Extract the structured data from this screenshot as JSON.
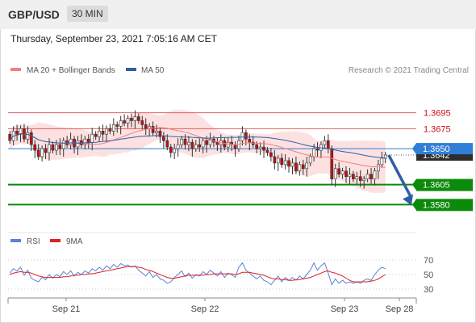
{
  "header": {
    "symbol": "GBP/USD",
    "timeframe": "30 MIN"
  },
  "datetime": "Thursday, September 23, 2021 7:05:16 AM CET",
  "copyright": "Research © 2021 Trading Central",
  "colors": {
    "ma20": "#f08080",
    "bands": "#fcd9d9",
    "ma50": "#2f5ea7",
    "resistance": "#e06060",
    "support": "#0c8a0c",
    "pivot": "#2f7ed8",
    "up": "#ffffff",
    "down": "#c01010",
    "rsi": "#5b82d6",
    "rsi_ma": "#dd2222",
    "arrow": "#2f5ea7"
  },
  "chart_data": [
    {
      "type": "candlestick",
      "legend": [
        "MA 20 + Bollinger Bands",
        "MA 50"
      ],
      "ylim": [
        1.355,
        1.3735
      ],
      "x_ticks": [
        "Sep 21",
        "Sep 22",
        "Sep 23",
        "Sep 28"
      ],
      "levels": [
        {
          "label": "1.3695",
          "value": 1.3695,
          "kind": "resistance"
        },
        {
          "label": "1.3675",
          "value": 1.3675,
          "kind": "resistance"
        },
        {
          "label": "1.3650",
          "value": 1.365,
          "kind": "pivot"
        },
        {
          "label": "1.3642",
          "value": 1.3642,
          "kind": "last"
        },
        {
          "label": "1.3605",
          "value": 1.3605,
          "kind": "support"
        },
        {
          "label": "1.3580",
          "value": 1.358,
          "kind": "support"
        }
      ],
      "closes": [
        1.366,
        1.3672,
        1.3668,
        1.3675,
        1.3662,
        1.367,
        1.3655,
        1.3648,
        1.364,
        1.365,
        1.3645,
        1.3655,
        1.3648,
        1.3655,
        1.365,
        1.366,
        1.3655,
        1.3662,
        1.3652,
        1.366,
        1.3655,
        1.3662,
        1.3658,
        1.3668,
        1.3665,
        1.3672,
        1.3668,
        1.3675,
        1.3672,
        1.368,
        1.3678,
        1.3685,
        1.3682,
        1.3688,
        1.3685,
        1.369,
        1.3685,
        1.368,
        1.3675,
        1.3678,
        1.367,
        1.3672,
        1.3665,
        1.366,
        1.3652,
        1.3645,
        1.365,
        1.3655,
        1.3662,
        1.3655,
        1.3658,
        1.365,
        1.3655,
        1.3652,
        1.366,
        1.3655,
        1.3662,
        1.3658,
        1.3655,
        1.366,
        1.3652,
        1.3658,
        1.3655,
        1.365,
        1.366,
        1.367,
        1.3662,
        1.3658,
        1.3655,
        1.365,
        1.3652,
        1.3648,
        1.3645,
        1.364,
        1.3632,
        1.3638,
        1.363,
        1.3635,
        1.3628,
        1.3632,
        1.3622,
        1.363,
        1.3625,
        1.3632,
        1.364,
        1.365,
        1.3648,
        1.3655,
        1.366,
        1.365,
        1.3612,
        1.3625,
        1.3618,
        1.3622,
        1.3615,
        1.3618,
        1.3612,
        1.3615,
        1.361,
        1.3612,
        1.3618,
        1.3612,
        1.3622,
        1.363,
        1.3638,
        1.3642
      ]
    },
    {
      "type": "line",
      "legend": [
        "RSI",
        "9MA"
      ],
      "ylim": [
        30,
        70
      ],
      "y_ticks": [
        70,
        50,
        30
      ],
      "series": [
        {
          "name": "RSI",
          "values": [
            52,
            58,
            55,
            60,
            49,
            56,
            45,
            42,
            40,
            46,
            43,
            50,
            45,
            50,
            47,
            54,
            50,
            55,
            48,
            53,
            50,
            55,
            52,
            58,
            55,
            60,
            56,
            62,
            58,
            64,
            60,
            65,
            62,
            63,
            60,
            62,
            56,
            52,
            48,
            54,
            46,
            50,
            44,
            42,
            38,
            40,
            46,
            50,
            55,
            47,
            52,
            45,
            50,
            48,
            54,
            50,
            56,
            52,
            48,
            54,
            46,
            52,
            50,
            46,
            60,
            66,
            56,
            52,
            48,
            44,
            48,
            42,
            40,
            36,
            42,
            48,
            40,
            46,
            42,
            46,
            42,
            48,
            44,
            50,
            56,
            66,
            56,
            62,
            66,
            52,
            36,
            44,
            38,
            42,
            38,
            40,
            38,
            40,
            38,
            42,
            44,
            42,
            50,
            56,
            60,
            58
          ]
        },
        {
          "name": "9MA",
          "values": [
            50,
            52,
            53,
            54,
            53,
            53,
            52,
            50,
            48,
            47,
            46,
            46,
            46,
            46,
            46,
            47,
            47,
            48,
            49,
            49,
            50,
            50,
            51,
            51,
            52,
            53,
            54,
            55,
            56,
            57,
            58,
            59,
            60,
            61,
            61,
            61,
            60,
            59,
            57,
            56,
            54,
            52,
            50,
            48,
            46,
            45,
            45,
            46,
            47,
            48,
            49,
            49,
            49,
            49,
            49,
            50,
            50,
            51,
            51,
            51,
            51,
            51,
            51,
            50,
            51,
            53,
            53,
            53,
            52,
            51,
            50,
            49,
            47,
            45,
            44,
            44,
            43,
            43,
            42,
            42,
            43,
            43,
            44,
            45,
            46,
            48,
            50,
            52,
            54,
            55,
            53,
            52,
            50,
            48,
            45,
            42,
            40,
            40,
            40,
            40,
            40,
            41,
            42,
            44,
            47,
            50
          ]
        }
      ]
    }
  ]
}
